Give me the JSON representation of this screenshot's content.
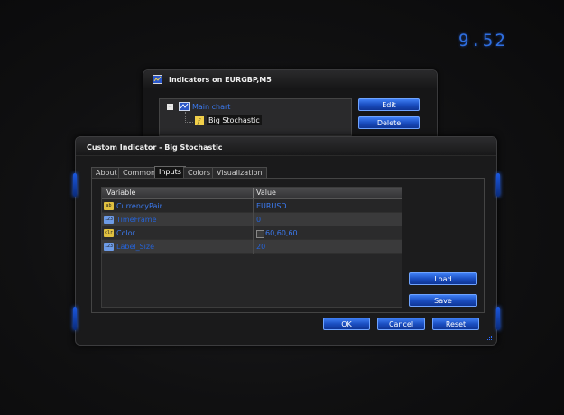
{
  "version": "9.52",
  "indicators_window": {
    "title": "Indicators on EURGBP,M5",
    "tree": {
      "expander": "−",
      "root_label": "Main chart",
      "child_label": "Big Stochastic"
    },
    "edit_label": "Edit",
    "delete_label": "Delete"
  },
  "dialog": {
    "title": "Custom Indicator - Big Stochastic",
    "tabs": [
      {
        "label": "About",
        "active": false
      },
      {
        "label": "Common",
        "active": false
      },
      {
        "label": "Inputs",
        "active": true
      },
      {
        "label": "Colors",
        "active": false
      },
      {
        "label": "Visualization",
        "active": false
      }
    ],
    "grid": {
      "columns": [
        "Variable",
        "Value"
      ],
      "rows": [
        {
          "icon": "ab",
          "icon_color": "#e0c040",
          "name": "CurrencyPair",
          "value": "EURUSD",
          "name_color": "#3b7af0",
          "value_color": "#3b7af0"
        },
        {
          "icon": "123",
          "icon_color": "#6d9be6",
          "name": "TimeFrame",
          "value": "0",
          "name_color": "#2563d8",
          "value_color": "#2563d8"
        },
        {
          "icon": "clr",
          "icon_color": "#e0c040",
          "name": "Color",
          "value": "60,60,60",
          "name_color": "#3b7af0",
          "value_color": "#3b7af0"
        },
        {
          "icon": "123",
          "icon_color": "#6d9be6",
          "name": "Label_Size",
          "value": "20",
          "name_color": "#2563d8",
          "value_color": "#2563d8"
        }
      ]
    },
    "load_label": "Load",
    "save_label": "Save",
    "ok_label": "OK",
    "cancel_label": "Cancel",
    "reset_label": "Reset"
  }
}
